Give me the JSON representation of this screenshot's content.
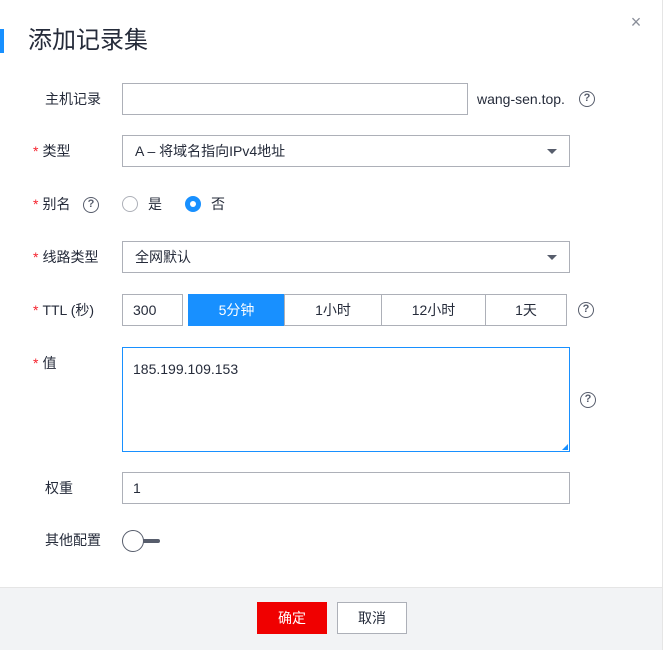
{
  "dialog": {
    "title": "添加记录集",
    "close_glyph": "×"
  },
  "form": {
    "required_mark": "*",
    "host_record": {
      "label": "主机记录",
      "value": "",
      "suffix": "wang-sen.top."
    },
    "type": {
      "label": "类型",
      "selected": "A – 将域名指向IPv4地址"
    },
    "alias": {
      "label": "别名",
      "options": [
        "是",
        "否"
      ],
      "selected": "否"
    },
    "line_type": {
      "label": "线路类型",
      "selected": "全网默认"
    },
    "ttl": {
      "label": "TTL (秒)",
      "value": "300",
      "presets": [
        "5分钟",
        "1小时",
        "12小时",
        "1天"
      ],
      "active_preset": "5分钟"
    },
    "value": {
      "label": "值",
      "text": "185.199.109.153"
    },
    "weight": {
      "label": "权重",
      "value": "1"
    },
    "other_config": {
      "label": "其他配置",
      "enabled": false
    }
  },
  "help_glyph": "?",
  "footer": {
    "confirm_label": "确定",
    "cancel_label": "取消"
  },
  "colors": {
    "accent": "#1890ff",
    "danger": "#f00000",
    "required": "#f5222d"
  }
}
